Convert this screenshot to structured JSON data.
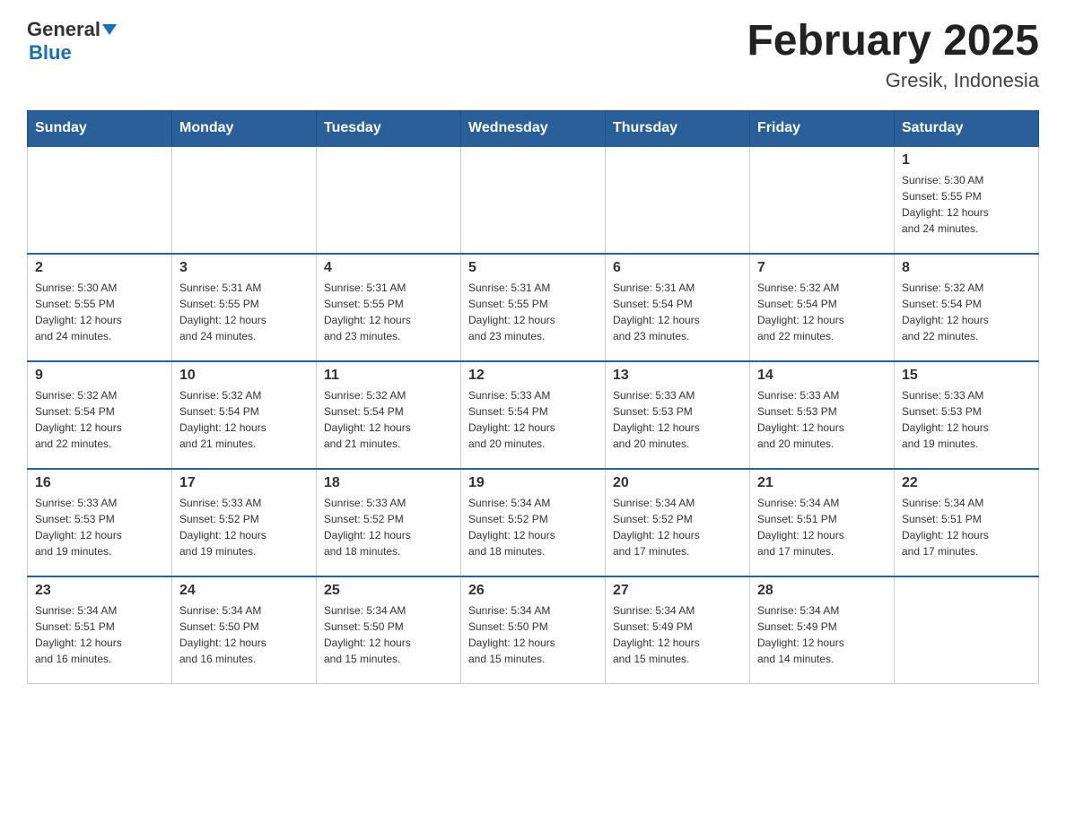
{
  "header": {
    "logo_general": "General",
    "logo_blue": "Blue",
    "month_title": "February 2025",
    "location": "Gresik, Indonesia"
  },
  "weekdays": [
    "Sunday",
    "Monday",
    "Tuesday",
    "Wednesday",
    "Thursday",
    "Friday",
    "Saturday"
  ],
  "weeks": [
    [
      {
        "day": "",
        "info": ""
      },
      {
        "day": "",
        "info": ""
      },
      {
        "day": "",
        "info": ""
      },
      {
        "day": "",
        "info": ""
      },
      {
        "day": "",
        "info": ""
      },
      {
        "day": "",
        "info": ""
      },
      {
        "day": "1",
        "info": "Sunrise: 5:30 AM\nSunset: 5:55 PM\nDaylight: 12 hours\nand 24 minutes."
      }
    ],
    [
      {
        "day": "2",
        "info": "Sunrise: 5:30 AM\nSunset: 5:55 PM\nDaylight: 12 hours\nand 24 minutes."
      },
      {
        "day": "3",
        "info": "Sunrise: 5:31 AM\nSunset: 5:55 PM\nDaylight: 12 hours\nand 24 minutes."
      },
      {
        "day": "4",
        "info": "Sunrise: 5:31 AM\nSunset: 5:55 PM\nDaylight: 12 hours\nand 23 minutes."
      },
      {
        "day": "5",
        "info": "Sunrise: 5:31 AM\nSunset: 5:55 PM\nDaylight: 12 hours\nand 23 minutes."
      },
      {
        "day": "6",
        "info": "Sunrise: 5:31 AM\nSunset: 5:54 PM\nDaylight: 12 hours\nand 23 minutes."
      },
      {
        "day": "7",
        "info": "Sunrise: 5:32 AM\nSunset: 5:54 PM\nDaylight: 12 hours\nand 22 minutes."
      },
      {
        "day": "8",
        "info": "Sunrise: 5:32 AM\nSunset: 5:54 PM\nDaylight: 12 hours\nand 22 minutes."
      }
    ],
    [
      {
        "day": "9",
        "info": "Sunrise: 5:32 AM\nSunset: 5:54 PM\nDaylight: 12 hours\nand 22 minutes."
      },
      {
        "day": "10",
        "info": "Sunrise: 5:32 AM\nSunset: 5:54 PM\nDaylight: 12 hours\nand 21 minutes."
      },
      {
        "day": "11",
        "info": "Sunrise: 5:32 AM\nSunset: 5:54 PM\nDaylight: 12 hours\nand 21 minutes."
      },
      {
        "day": "12",
        "info": "Sunrise: 5:33 AM\nSunset: 5:54 PM\nDaylight: 12 hours\nand 20 minutes."
      },
      {
        "day": "13",
        "info": "Sunrise: 5:33 AM\nSunset: 5:53 PM\nDaylight: 12 hours\nand 20 minutes."
      },
      {
        "day": "14",
        "info": "Sunrise: 5:33 AM\nSunset: 5:53 PM\nDaylight: 12 hours\nand 20 minutes."
      },
      {
        "day": "15",
        "info": "Sunrise: 5:33 AM\nSunset: 5:53 PM\nDaylight: 12 hours\nand 19 minutes."
      }
    ],
    [
      {
        "day": "16",
        "info": "Sunrise: 5:33 AM\nSunset: 5:53 PM\nDaylight: 12 hours\nand 19 minutes."
      },
      {
        "day": "17",
        "info": "Sunrise: 5:33 AM\nSunset: 5:52 PM\nDaylight: 12 hours\nand 19 minutes."
      },
      {
        "day": "18",
        "info": "Sunrise: 5:33 AM\nSunset: 5:52 PM\nDaylight: 12 hours\nand 18 minutes."
      },
      {
        "day": "19",
        "info": "Sunrise: 5:34 AM\nSunset: 5:52 PM\nDaylight: 12 hours\nand 18 minutes."
      },
      {
        "day": "20",
        "info": "Sunrise: 5:34 AM\nSunset: 5:52 PM\nDaylight: 12 hours\nand 17 minutes."
      },
      {
        "day": "21",
        "info": "Sunrise: 5:34 AM\nSunset: 5:51 PM\nDaylight: 12 hours\nand 17 minutes."
      },
      {
        "day": "22",
        "info": "Sunrise: 5:34 AM\nSunset: 5:51 PM\nDaylight: 12 hours\nand 17 minutes."
      }
    ],
    [
      {
        "day": "23",
        "info": "Sunrise: 5:34 AM\nSunset: 5:51 PM\nDaylight: 12 hours\nand 16 minutes."
      },
      {
        "day": "24",
        "info": "Sunrise: 5:34 AM\nSunset: 5:50 PM\nDaylight: 12 hours\nand 16 minutes."
      },
      {
        "day": "25",
        "info": "Sunrise: 5:34 AM\nSunset: 5:50 PM\nDaylight: 12 hours\nand 15 minutes."
      },
      {
        "day": "26",
        "info": "Sunrise: 5:34 AM\nSunset: 5:50 PM\nDaylight: 12 hours\nand 15 minutes."
      },
      {
        "day": "27",
        "info": "Sunrise: 5:34 AM\nSunset: 5:49 PM\nDaylight: 12 hours\nand 15 minutes."
      },
      {
        "day": "28",
        "info": "Sunrise: 5:34 AM\nSunset: 5:49 PM\nDaylight: 12 hours\nand 14 minutes."
      },
      {
        "day": "",
        "info": ""
      }
    ]
  ]
}
